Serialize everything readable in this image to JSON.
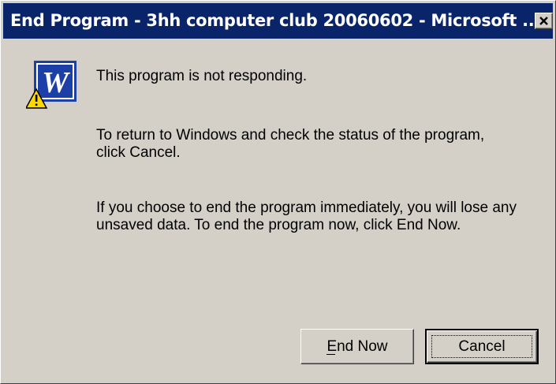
{
  "dialog": {
    "title": "End Program - 3hh computer club 20060602 - Microsoft ...",
    "close_icon": "close-x-icon",
    "app_icon": "word-w-warning-icon",
    "messages": [
      "This program is not responding.",
      "To return to Windows and check the status of the program, click Cancel.",
      "If you choose to end the program immediately, you will lose any unsaved data. To end the program now, click End Now."
    ],
    "buttons": {
      "end_now": "End Now",
      "cancel": "Cancel"
    },
    "colors": {
      "titlebar": "#0a246a",
      "face": "#d4d0c8",
      "word_blue": "#1c3fa8"
    }
  }
}
